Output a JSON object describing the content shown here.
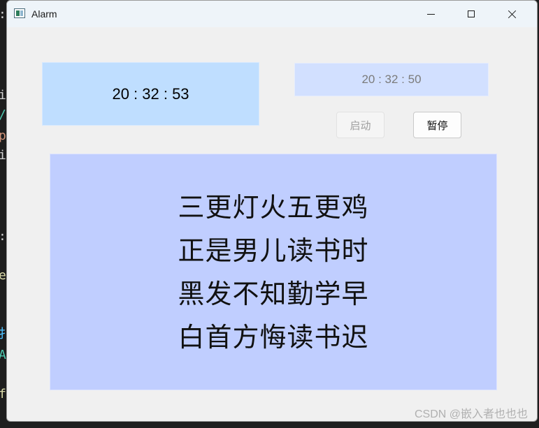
{
  "window": {
    "title": "Alarm"
  },
  "clock": {
    "current_time": "20 : 32 : 53"
  },
  "alarm": {
    "time": "20 : 32 : 50",
    "start_label": "启动",
    "pause_label": "暂停"
  },
  "poem": {
    "lines": [
      "三更灯火五更鸡",
      "正是男儿读书时",
      "黑发不知勤学早",
      "白首方悔读书迟"
    ]
  },
  "watermark": {
    "text": "CSDN @嵌入者也也也"
  },
  "background_code": {
    "chars": [
      ":",
      "i",
      "/",
      "p",
      "i",
      ":",
      "e",
      "扌",
      "A",
      "f"
    ],
    "colors": [
      "#d4d4d4",
      "#d4d4d4",
      "#4ec9b0",
      "#ce9178",
      "#d4d4d4",
      "#d4d4d4",
      "#dcdcaa",
      "#4fc1ff",
      "#4ec9b0",
      "#dcdcaa"
    ]
  },
  "colors": {
    "clock_bg": "#bfdeff",
    "alarm_time_bg": "#d2e0ff",
    "poem_bg": "#c0ceff",
    "window_bg": "#f0f0f0"
  },
  "icons": {
    "app": "app-window-icon",
    "minimize": "minimize-icon",
    "maximize": "maximize-icon",
    "close": "close-icon"
  }
}
